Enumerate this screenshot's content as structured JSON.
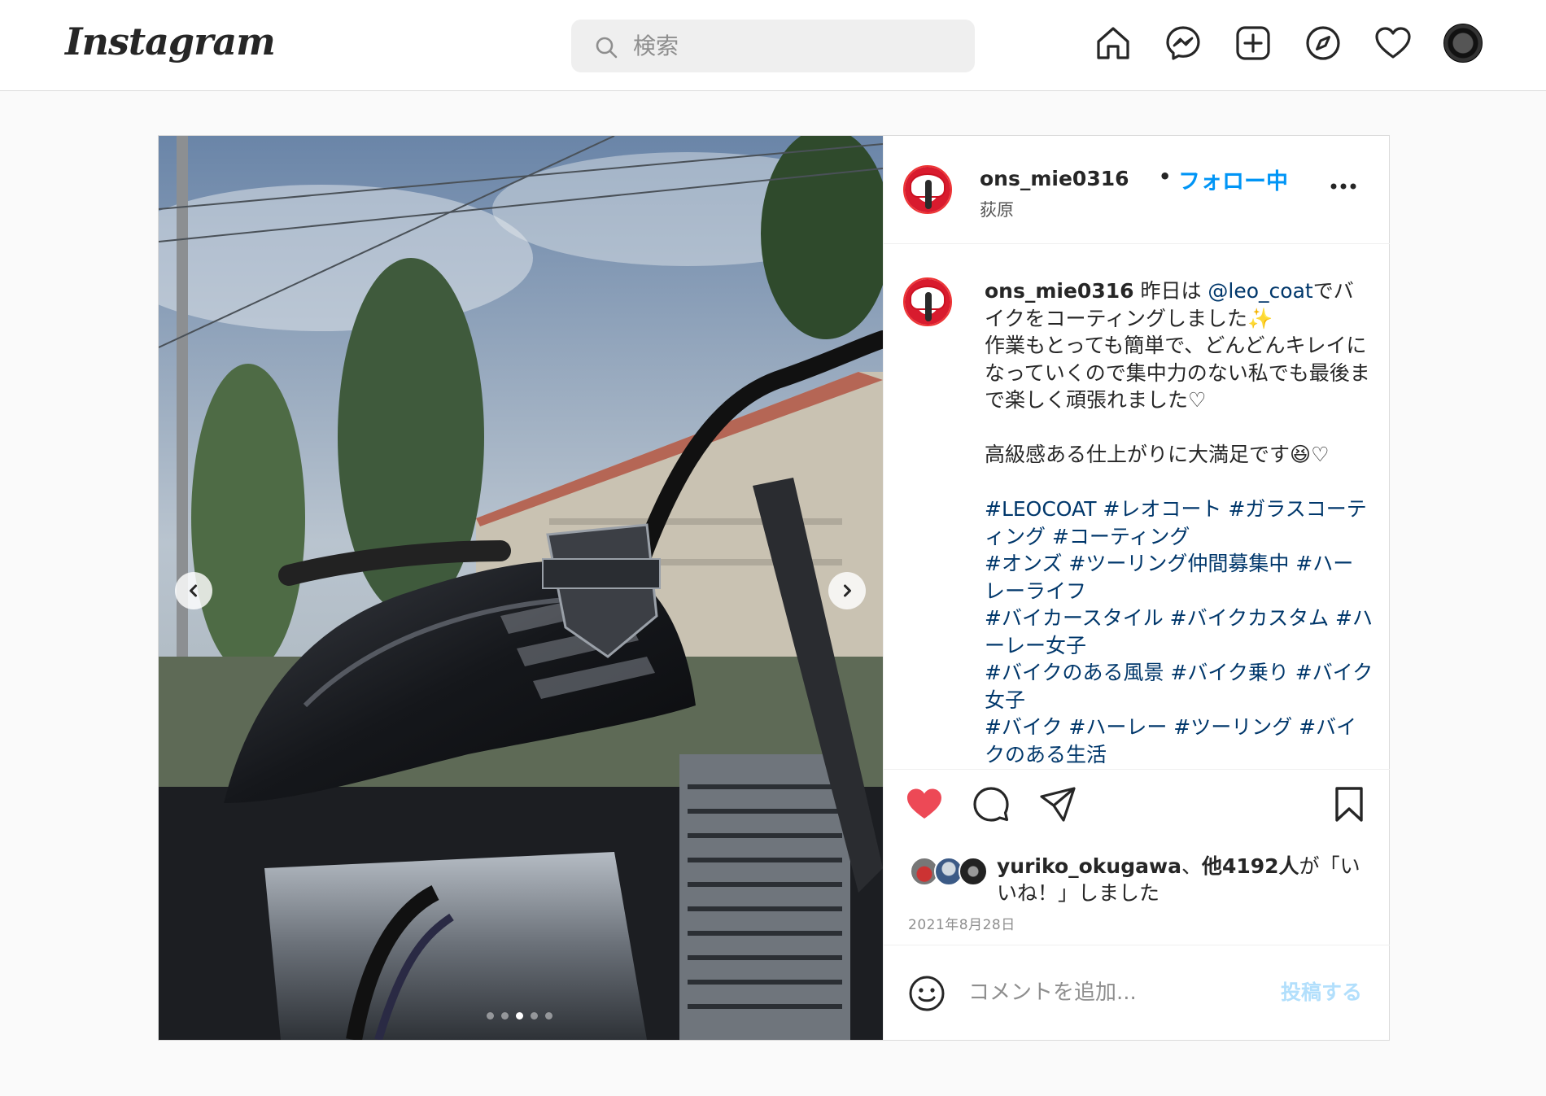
{
  "header": {
    "logo_text": "Instagram",
    "search_placeholder": "検索",
    "nav_icons": [
      "home-icon",
      "messenger-icon",
      "new-post-icon",
      "explore-icon",
      "activity-heart-icon",
      "profile-avatar"
    ]
  },
  "post": {
    "username": "ons_mie0316",
    "separator": "•",
    "follow_status": "フォロー中",
    "location": "荻原",
    "carousel": {
      "total": 5,
      "active_index": 2
    },
    "caption": {
      "username": "ons_mie0316",
      "text_before_mention": " 昨日は ",
      "mention": "@leo_coat",
      "text_after_mention": "でバイクをコーティングしました✨\n作業もとっても簡単で、どんどんキレイになっていくので集中力のない私でも最後まで楽しく頑張れました♡\n\n高級感ある仕上がりに大満足です😆♡\n\n",
      "hashtags": "#LEOCOAT #レオコート #ガラスコーティング #コーティング\n#オンズ #ツーリング仲間募集中 #ハーレーライフ\n#バイカースタイル #バイクカスタム #ハーレー女子\n#バイクのある風景 #バイク乗り #バイク女子\n#バイク #ハーレー #ツーリング #バイクのある生活"
    },
    "likes": {
      "first_liker": "yuriko_okugawa",
      "joiner": "、",
      "others": "他4192人",
      "suffix": "が「いいね！」しました"
    },
    "date": "2021年8月28日",
    "comment_placeholder": "コメントを追加...",
    "post_button": "投稿する",
    "colors": {
      "accent": "#0095f6",
      "like": "#ed4956",
      "hashtag": "#00376b"
    }
  }
}
